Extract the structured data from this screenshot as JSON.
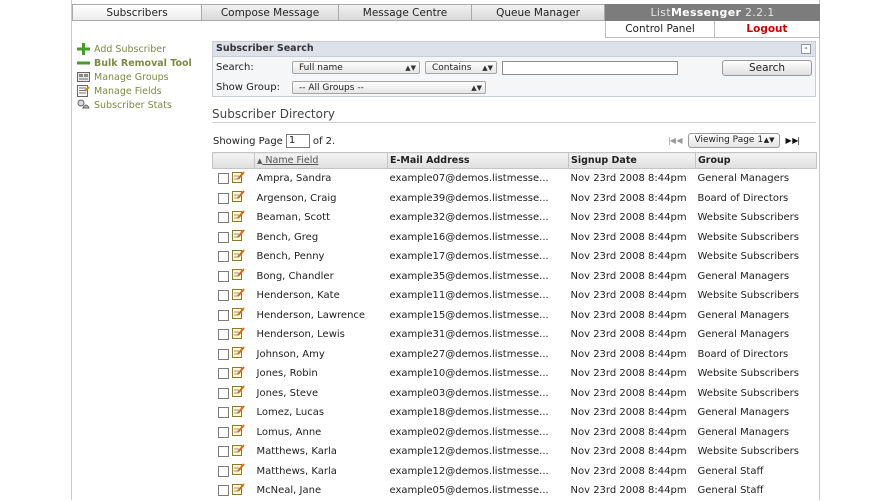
{
  "tabs": [
    "Subscribers",
    "Compose Message",
    "Message Centre",
    "Queue Manager"
  ],
  "brand": {
    "name_light": "List",
    "name_bold": "Messenger",
    "version": "2.2.1"
  },
  "subtabs": {
    "control_panel": "Control Panel",
    "logout": "Logout"
  },
  "colors": {
    "logout": "#c80000",
    "sidebar_link": "#7d8a45",
    "brand_bg": "#7c7c7c"
  },
  "sidebar": {
    "items": [
      {
        "label": "Add Subscriber",
        "icon": "plus-icon",
        "bold": false
      },
      {
        "label": "Bulk Removal Tool",
        "icon": "minus-icon",
        "bold": true
      },
      {
        "label": "Manage Groups",
        "icon": "groups-icon",
        "bold": false
      },
      {
        "label": "Manage Fields",
        "icon": "fields-icon",
        "bold": false
      },
      {
        "label": "Subscriber Stats",
        "icon": "stats-icon",
        "bold": false
      }
    ]
  },
  "search": {
    "header": "Subscriber Search",
    "search_label": "Search:",
    "field_select": "Full name",
    "operator_select": "Contains",
    "query_value": "",
    "group_label": "Show Group:",
    "group_select": "-- All Groups --",
    "button": "Search"
  },
  "directory": {
    "title": "Subscriber Directory",
    "showing_prefix": "Showing Page",
    "page_value": "1",
    "page_suffix": "of 2.",
    "viewing_select": "Viewing Page 1"
  },
  "table": {
    "columns": [
      "Name Field",
      "E-Mail Address",
      "Signup Date",
      "Group"
    ],
    "rows": [
      {
        "name": "Ampra, Sandra",
        "email": "example07@demos.listmesse...",
        "date": "Nov 23rd 2008 8:44pm",
        "group": "General Managers"
      },
      {
        "name": "Argenson, Craig",
        "email": "example39@demos.listmesse...",
        "date": "Nov 23rd 2008 8:44pm",
        "group": "Board of Directors"
      },
      {
        "name": "Beaman, Scott",
        "email": "example32@demos.listmesse...",
        "date": "Nov 23rd 2008 8:44pm",
        "group": "Website Subscribers"
      },
      {
        "name": "Bench, Greg",
        "email": "example16@demos.listmesse...",
        "date": "Nov 23rd 2008 8:44pm",
        "group": "Website Subscribers"
      },
      {
        "name": "Bench, Penny",
        "email": "example17@demos.listmesse...",
        "date": "Nov 23rd 2008 8:44pm",
        "group": "Website Subscribers"
      },
      {
        "name": "Bong, Chandler",
        "email": "example35@demos.listmesse...",
        "date": "Nov 23rd 2008 8:44pm",
        "group": "General Managers"
      },
      {
        "name": "Henderson, Kate",
        "email": "example11@demos.listmesse...",
        "date": "Nov 23rd 2008 8:44pm",
        "group": "Website Subscribers"
      },
      {
        "name": "Henderson, Lawrence",
        "email": "example15@demos.listmesse...",
        "date": "Nov 23rd 2008 8:44pm",
        "group": "General Managers"
      },
      {
        "name": "Henderson, Lewis",
        "email": "example31@demos.listmesse...",
        "date": "Nov 23rd 2008 8:44pm",
        "group": "General Managers"
      },
      {
        "name": "Johnson, Amy",
        "email": "example27@demos.listmesse...",
        "date": "Nov 23rd 2008 8:44pm",
        "group": "Board of Directors"
      },
      {
        "name": "Jones, Robin",
        "email": "example10@demos.listmesse...",
        "date": "Nov 23rd 2008 8:44pm",
        "group": "Website Subscribers"
      },
      {
        "name": "Jones, Steve",
        "email": "example03@demos.listmesse...",
        "date": "Nov 23rd 2008 8:44pm",
        "group": "Website Subscribers"
      },
      {
        "name": "Lomez, Lucas",
        "email": "example18@demos.listmesse...",
        "date": "Nov 23rd 2008 8:44pm",
        "group": "General Managers"
      },
      {
        "name": "Lomus, Anne",
        "email": "example02@demos.listmesse...",
        "date": "Nov 23rd 2008 8:44pm",
        "group": "General Managers"
      },
      {
        "name": "Matthews, Karla",
        "email": "example12@demos.listmesse...",
        "date": "Nov 23rd 2008 8:44pm",
        "group": "Website Subscribers"
      },
      {
        "name": "Matthews, Karla",
        "email": "example12@demos.listmesse...",
        "date": "Nov 23rd 2008 8:44pm",
        "group": "General Staff"
      },
      {
        "name": "McNeal, Jane",
        "email": "example05@demos.listmesse...",
        "date": "Nov 23rd 2008 8:44pm",
        "group": "General Staff"
      }
    ]
  }
}
